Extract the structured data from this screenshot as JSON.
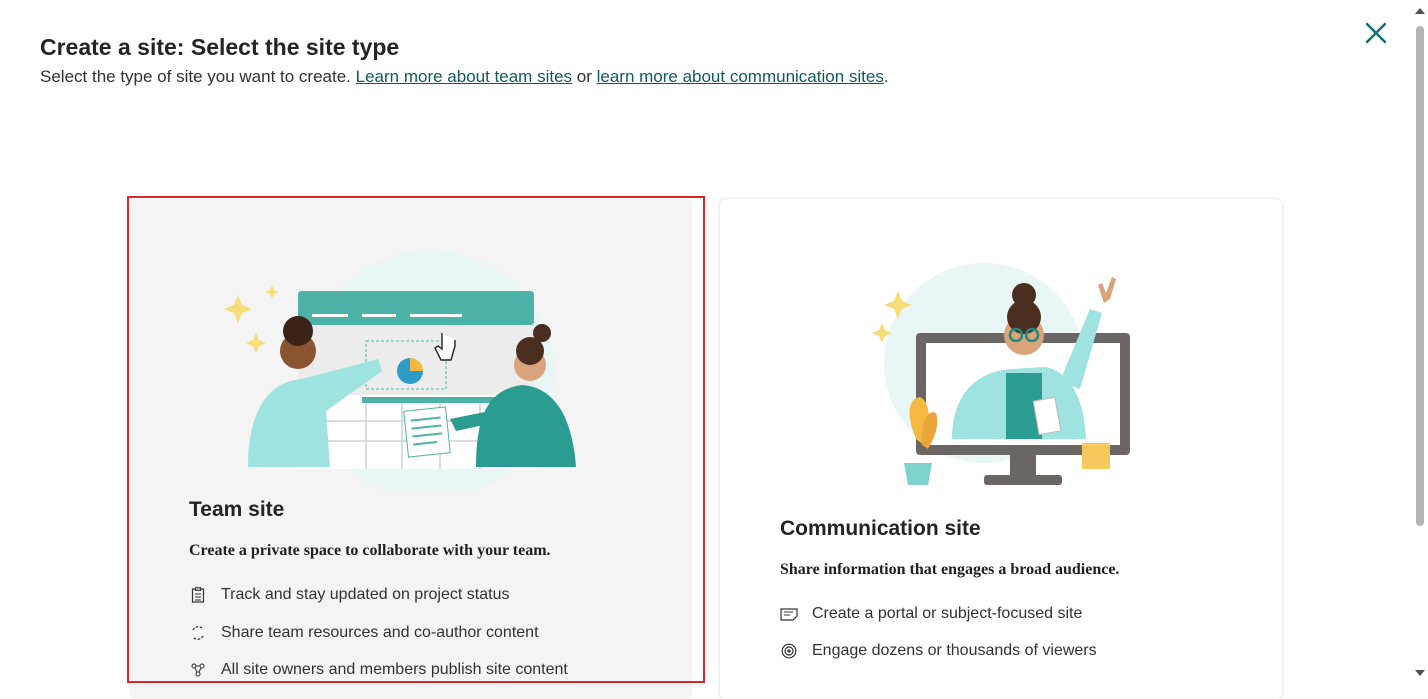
{
  "header": {
    "title": "Create a site: Select the site type",
    "description_prefix": "Select the type of site you want to create. ",
    "team_link": "Learn more about team sites",
    "middle": " or ",
    "comm_link": "learn more about communication sites",
    "suffix": "."
  },
  "close_icon": "close-icon",
  "cards": [
    {
      "title": "Team site",
      "subtitle": "Create a private space to collaborate with your team.",
      "selected": true,
      "features": [
        {
          "icon": "clipboard-icon",
          "label": "Track and stay updated on project status"
        },
        {
          "icon": "sync-icon",
          "label": "Share team resources and co-author content"
        },
        {
          "icon": "people-network-icon",
          "label": "All site owners and members publish site content"
        }
      ]
    },
    {
      "title": "Communication site",
      "subtitle": "Share information that engages a broad audience.",
      "selected": false,
      "features": [
        {
          "icon": "news-icon",
          "label": "Create a portal or subject-focused site"
        },
        {
          "icon": "broadcast-icon",
          "label": "Engage dozens or thousands of viewers"
        }
      ]
    }
  ],
  "colors": {
    "accent": "#0f5a62",
    "selection_border": "#d9262c",
    "teal": "#4db3a9"
  }
}
